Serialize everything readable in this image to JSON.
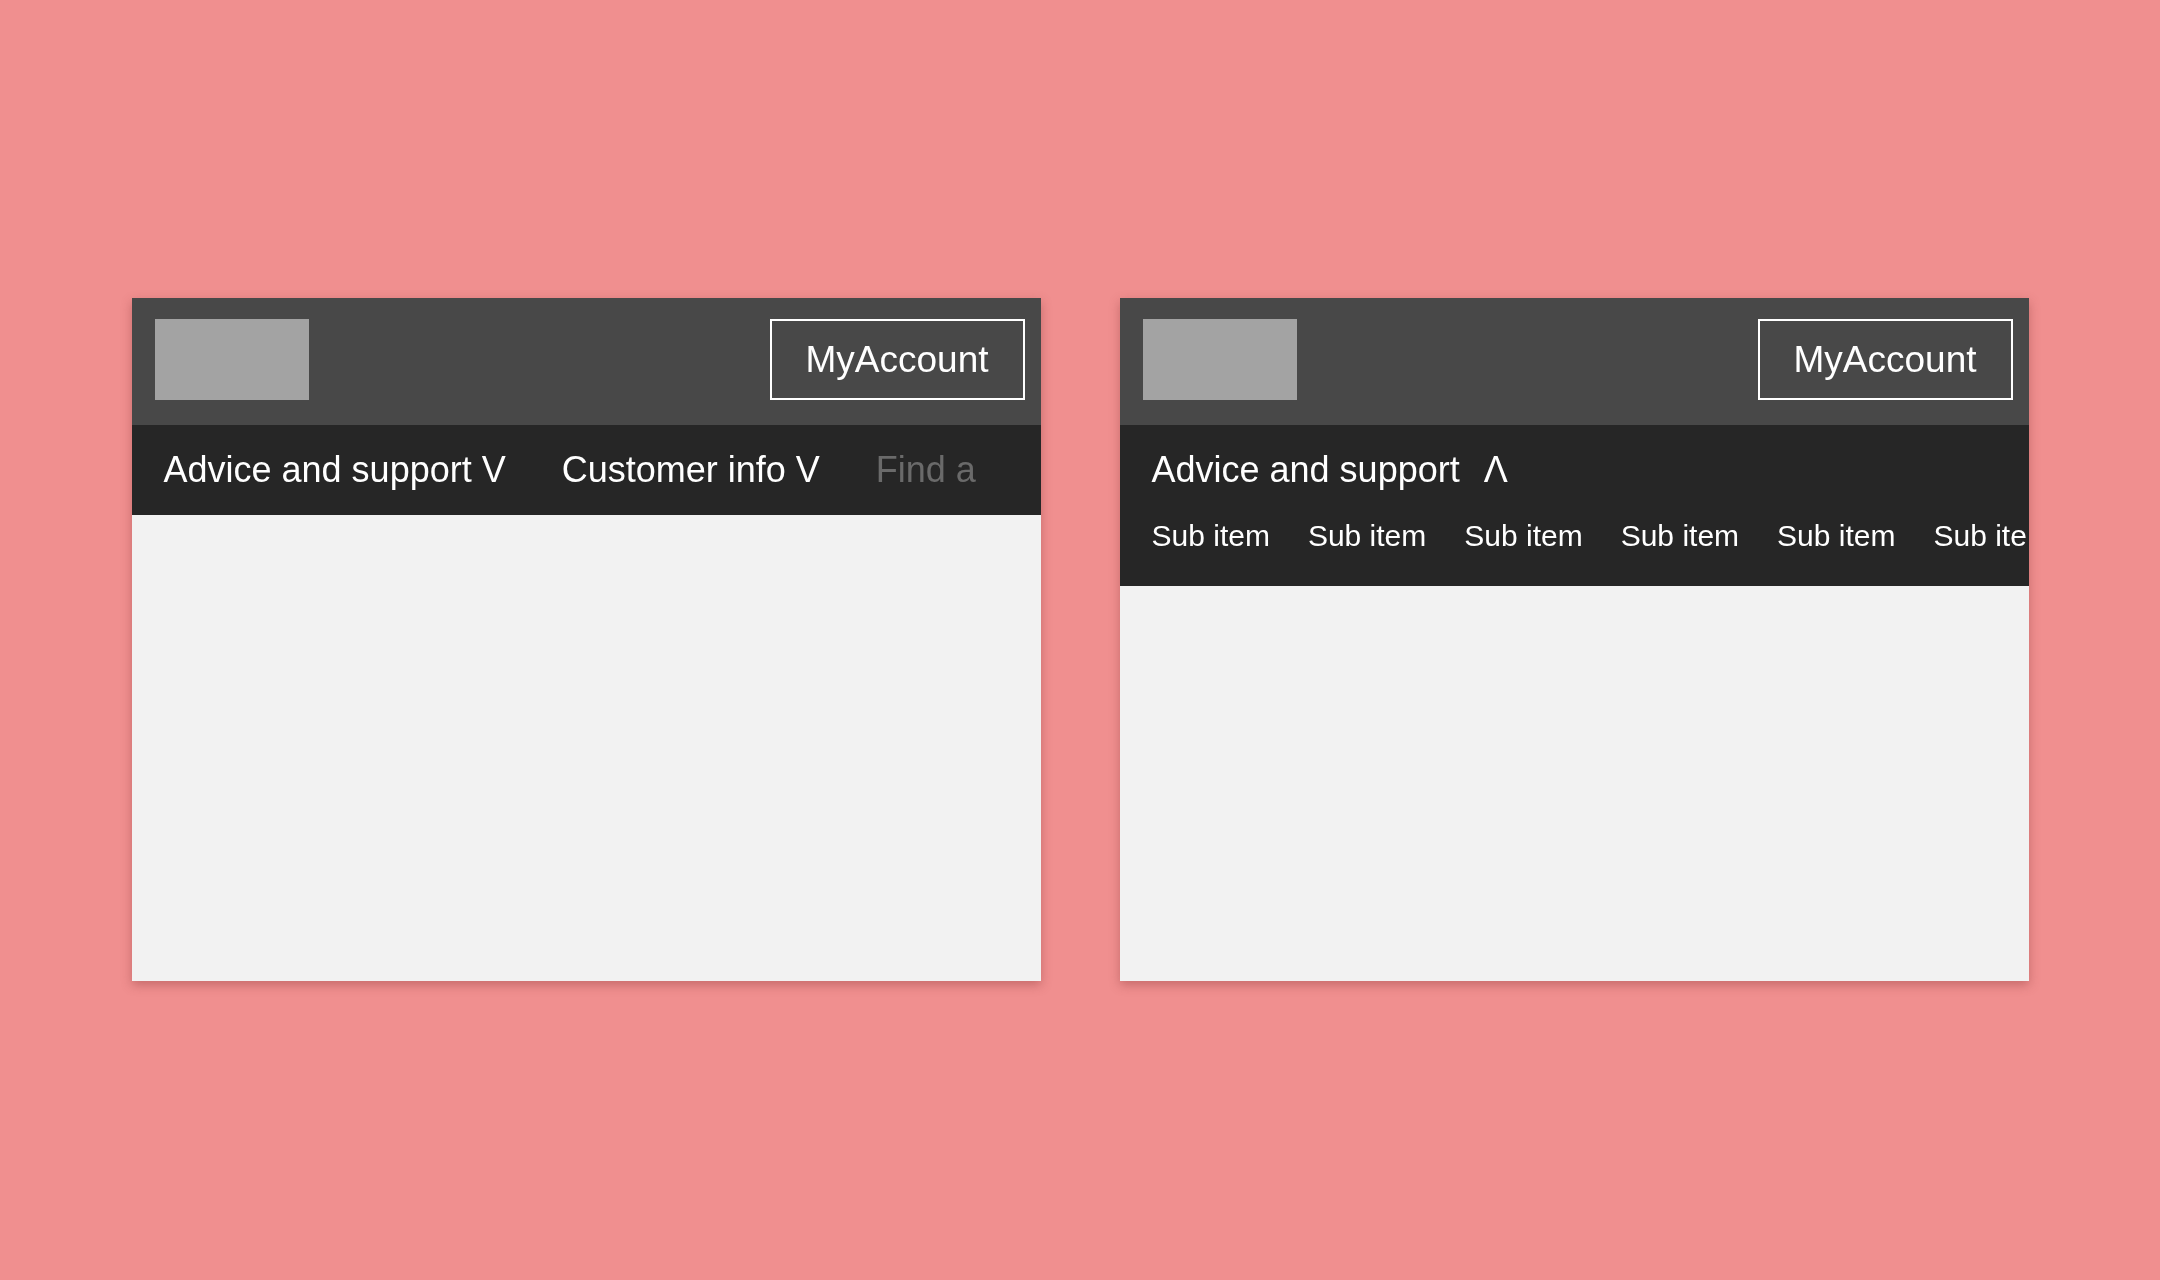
{
  "panels": [
    {
      "header": {
        "account_button": "MyAccount"
      },
      "nav": {
        "items": [
          {
            "label": "Advice and support V",
            "faded": false
          },
          {
            "label": "Customer info V",
            "faded": false
          },
          {
            "label": "Find a",
            "faded": true
          }
        ]
      }
    },
    {
      "header": {
        "account_button": "MyAccount"
      },
      "nav": {
        "items": [
          {
            "label": "Advice and support",
            "caret": "Λ",
            "expanded": true,
            "sub_items": [
              "Sub item",
              "Sub item",
              "Sub item",
              "Sub item",
              "Sub item",
              "Sub ite"
            ]
          }
        ]
      }
    }
  ]
}
